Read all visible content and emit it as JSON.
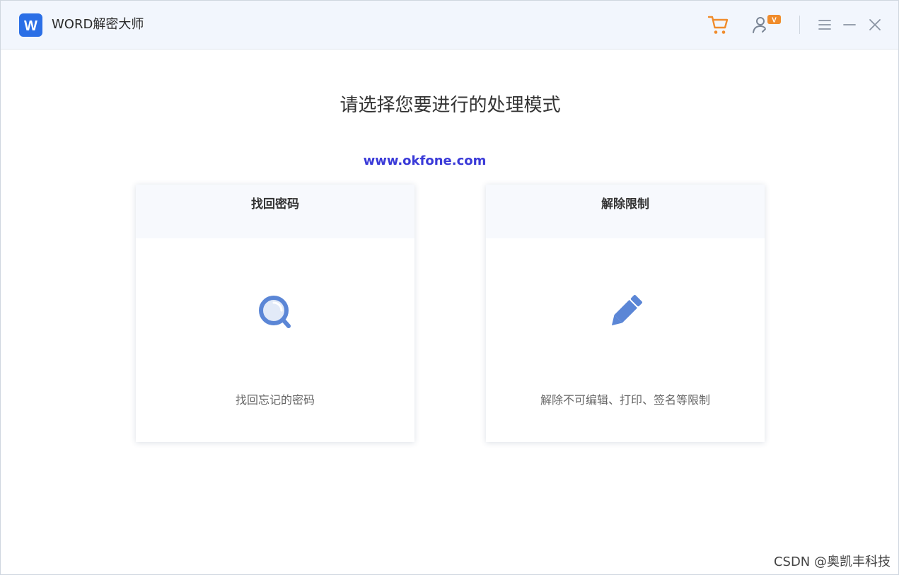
{
  "titlebar": {
    "app_title": "WORD解密大师",
    "logo_letter": "W",
    "user_badge": "V"
  },
  "main": {
    "heading": "请选择您要进行的处理模式",
    "site_watermark": "www.okfone.com",
    "cards": [
      {
        "title": "找回密码",
        "description": "找回忘记的密码",
        "icon": "magnifier-icon"
      },
      {
        "title": "解除限制",
        "description": "解除不可编辑、打印、签名等限制",
        "icon": "pencil-icon"
      }
    ]
  },
  "footer": {
    "csdn_watermark": "CSDN @奥凯丰科技"
  },
  "colors": {
    "brand_blue": "#2b6fe6",
    "icon_blue": "#5b86d6",
    "accent_orange": "#f08c2c",
    "titlebar_bg": "#f2f6fd",
    "card_header_bg": "#f7f9fd"
  }
}
